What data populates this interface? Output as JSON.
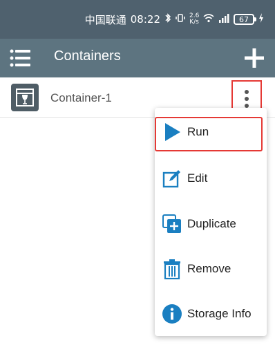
{
  "status_bar": {
    "carrier": "中国联通",
    "time": "08:22",
    "network_speed": "2.6 K/s",
    "battery": "67"
  },
  "app_bar": {
    "title": "Containers"
  },
  "containers": [
    {
      "name": "Container-1"
    }
  ],
  "context_menu": {
    "items": [
      {
        "label": "Run",
        "icon": "play-icon"
      },
      {
        "label": "Edit",
        "icon": "edit-icon"
      },
      {
        "label": "Duplicate",
        "icon": "duplicate-icon"
      },
      {
        "label": "Remove",
        "icon": "trash-icon"
      },
      {
        "label": "Storage Info",
        "icon": "info-icon"
      }
    ]
  },
  "colors": {
    "status_bar_bg": "#4f616e",
    "app_bar_bg": "#5d7480",
    "accent_blue": "#1a7fc1",
    "highlight_red": "#e53935"
  }
}
